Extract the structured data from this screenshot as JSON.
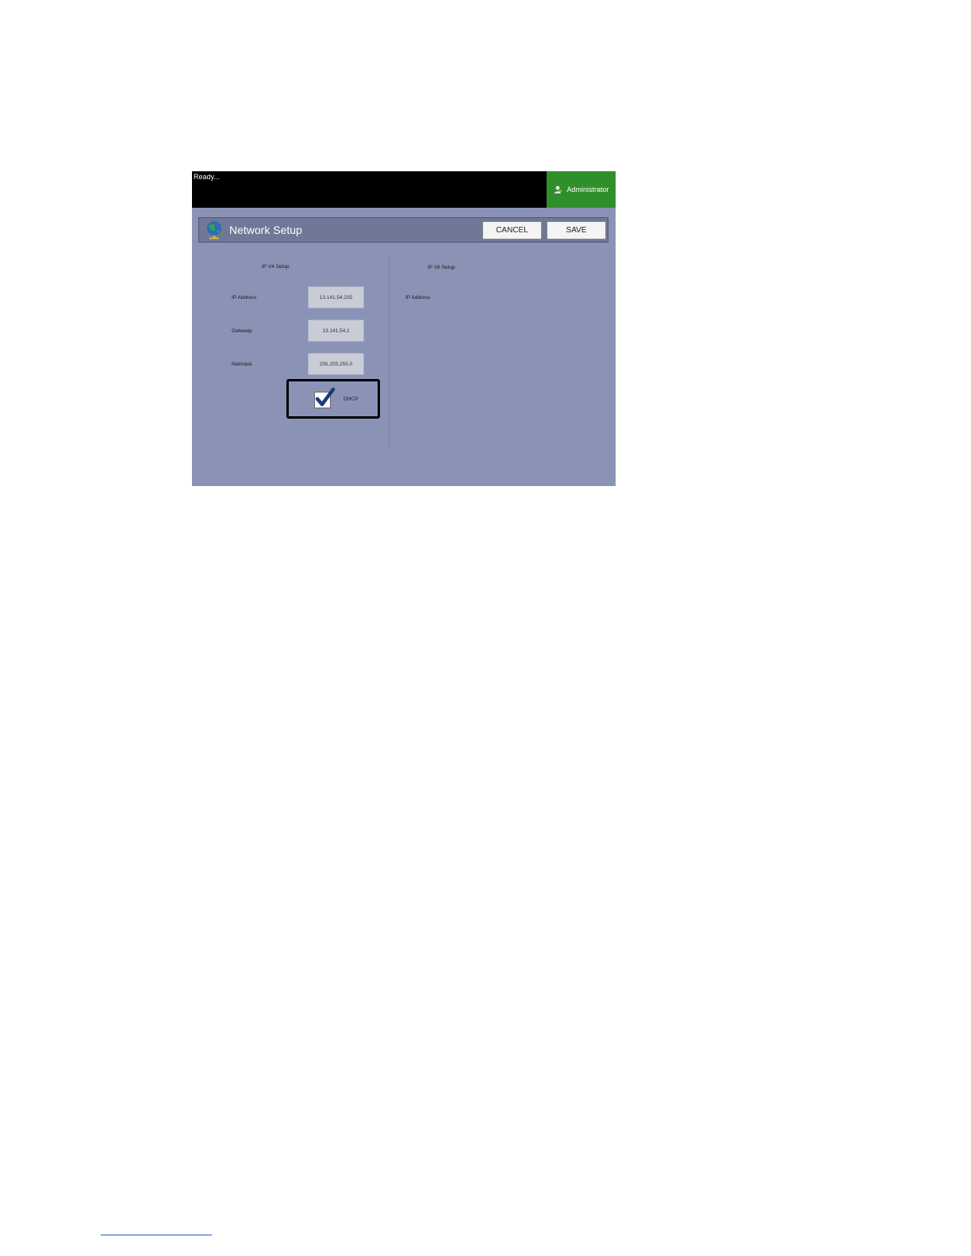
{
  "status_bar": {
    "status_text": "Ready...",
    "user_label": "Administrator"
  },
  "header": {
    "title": "Network Setup",
    "cancel_label": "CANCEL",
    "save_label": "SAVE"
  },
  "ipv4": {
    "heading": "IP V4 Setup",
    "fields": [
      {
        "label": "IP Address",
        "value": "13.141.54.235"
      },
      {
        "label": "Gateway",
        "value": "13.141.54.1"
      },
      {
        "label": "Netmask",
        "value": "255.255.255.0"
      }
    ],
    "dhcp": {
      "label": "DHCP",
      "checked": true
    }
  },
  "ipv6": {
    "heading": "IP V6 Setup",
    "fields": [
      {
        "label": "IP Address"
      }
    ]
  },
  "colors": {
    "panel": "#8a93b5",
    "status_bar": "#000000",
    "admin": "#2f8f2a",
    "title_bar": "#6f7896"
  },
  "icons": [
    "user-key-icon",
    "globe-icon",
    "checkmark-icon"
  ]
}
